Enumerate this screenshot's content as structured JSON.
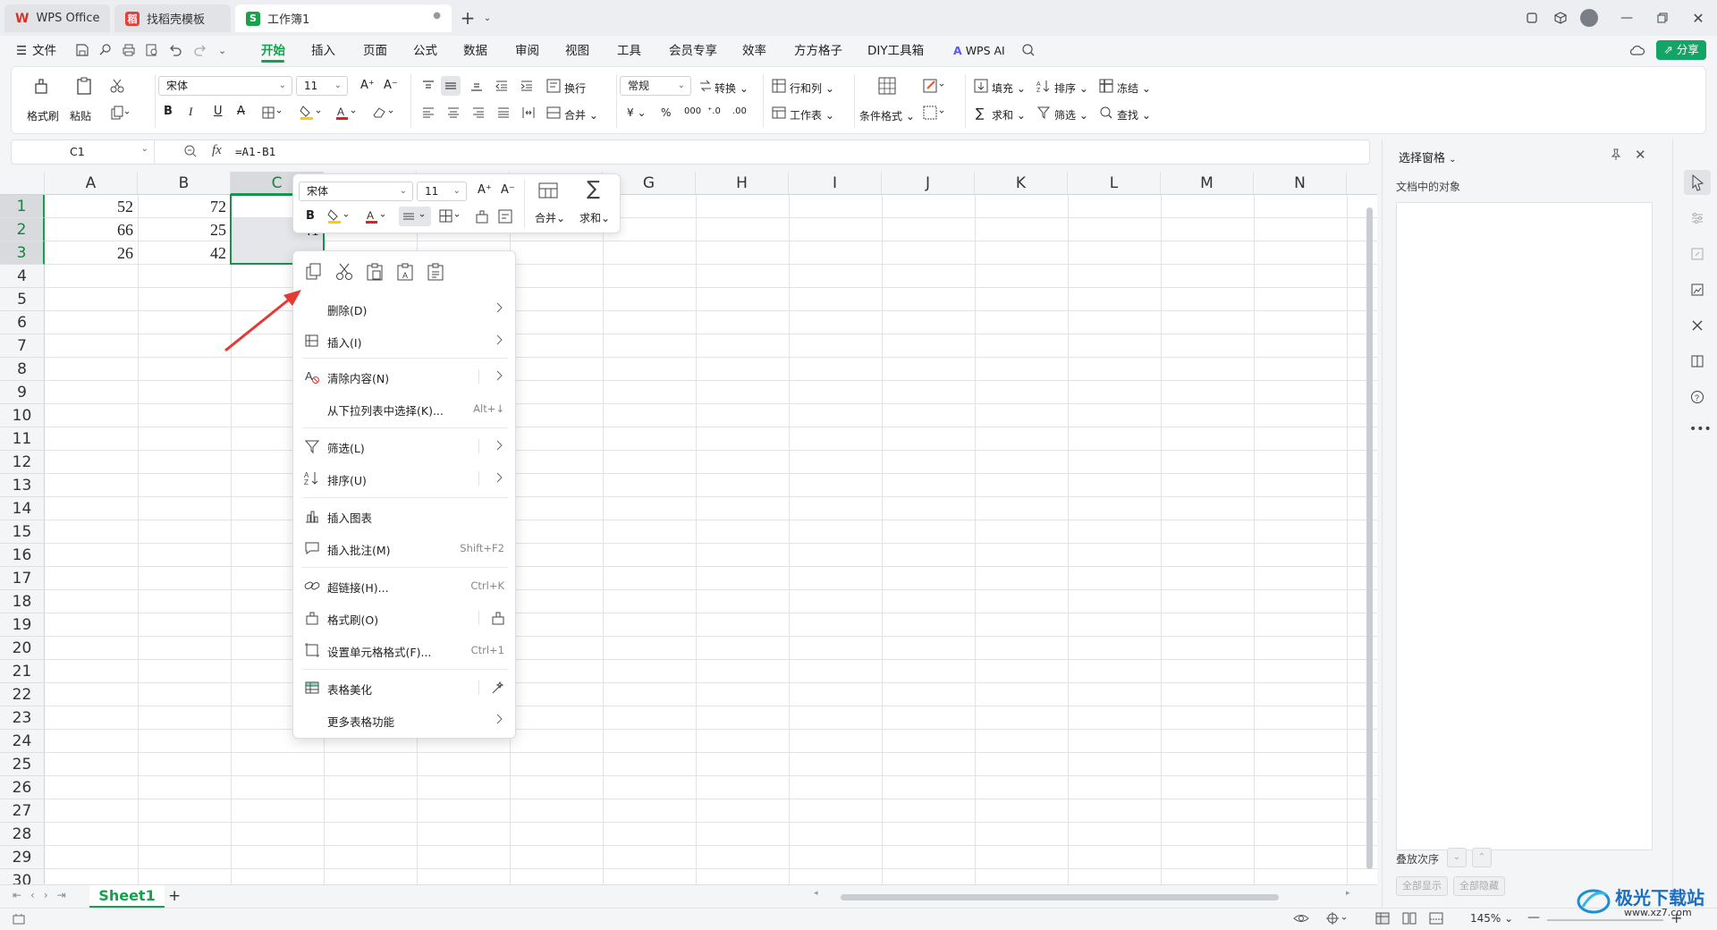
{
  "titlebar": {
    "tabs": [
      {
        "label": "WPS Office",
        "icon": "wps-logo-icon"
      },
      {
        "label": "找稻壳模板",
        "icon": "docer-icon"
      },
      {
        "label": "工作簿1",
        "icon": "spreadsheet-icon"
      }
    ]
  },
  "menubar": {
    "file": "文件",
    "items": [
      "开始",
      "插入",
      "页面",
      "公式",
      "数据",
      "审阅",
      "视图",
      "工具",
      "会员专享",
      "效率",
      "方方格子",
      "DIY工具箱"
    ],
    "wps_ai": "WPS AI",
    "share": "分享"
  },
  "ribbon": {
    "format_painter": "格式刷",
    "paste": "粘贴",
    "font_name": "宋体",
    "font_size": "11",
    "wrap": "换行",
    "merge": "合并",
    "number_format": "常规",
    "convert": "转换",
    "row_col": "行和列",
    "worksheet": "工作表",
    "cond_format": "条件格式",
    "fill": "填充",
    "sort": "排序",
    "freeze": "冻结",
    "sum": "求和",
    "filter": "筛选",
    "find": "查找"
  },
  "formula": {
    "namebox": "C1",
    "fx": "fx",
    "content": "=A1-B1"
  },
  "sheet": {
    "columns": [
      "A",
      "B",
      "C",
      "D",
      "E",
      "F",
      "G",
      "H",
      "I",
      "J",
      "K",
      "L",
      "M",
      "N"
    ],
    "rows": [
      "1",
      "2",
      "3",
      "4",
      "5",
      "6",
      "7",
      "8",
      "9",
      "10",
      "11",
      "12",
      "13",
      "14",
      "15",
      "16",
      "17",
      "18",
      "19",
      "20",
      "21",
      "22",
      "23",
      "24",
      "25",
      "26",
      "27",
      "28",
      "29",
      "30"
    ],
    "cells": {
      "A1": "52",
      "B1": "72",
      "A2": "66",
      "B2": "25",
      "C2": "41",
      "A3": "26",
      "B3": "42"
    },
    "sheet_tab": "Sheet1"
  },
  "minitoolbar": {
    "font_name": "宋体",
    "font_size": "11",
    "merge": "合并",
    "sum": "求和"
  },
  "context_menu": {
    "items": [
      {
        "label": "删除(D)",
        "shortcut": ""
      },
      {
        "label": "插入(I)",
        "shortcut": ""
      },
      {
        "label": "清除内容(N)",
        "shortcut": ""
      },
      {
        "label": "从下拉列表中选择(K)...",
        "shortcut": "Alt+↓"
      },
      {
        "label": "筛选(L)",
        "shortcut": ""
      },
      {
        "label": "排序(U)",
        "shortcut": ""
      },
      {
        "label": "插入图表",
        "shortcut": ""
      },
      {
        "label": "插入批注(M)",
        "shortcut": "Shift+F2"
      },
      {
        "label": "超链接(H)...",
        "shortcut": "Ctrl+K"
      },
      {
        "label": "格式刷(O)",
        "shortcut": ""
      },
      {
        "label": "设置单元格格式(F)...",
        "shortcut": "Ctrl+1"
      },
      {
        "label": "表格美化",
        "shortcut": ""
      },
      {
        "label": "更多表格功能",
        "shortcut": ""
      }
    ]
  },
  "sidepanel": {
    "title": "选择窗格",
    "subtitle": "文档中的对象",
    "stack_order": "叠放次序",
    "show_all": "全部显示",
    "hide_all": "全部隐藏"
  },
  "statusbar": {
    "zoom": "145%"
  },
  "watermark": {
    "text": "极光下载站",
    "url": "www.xz7.com"
  }
}
